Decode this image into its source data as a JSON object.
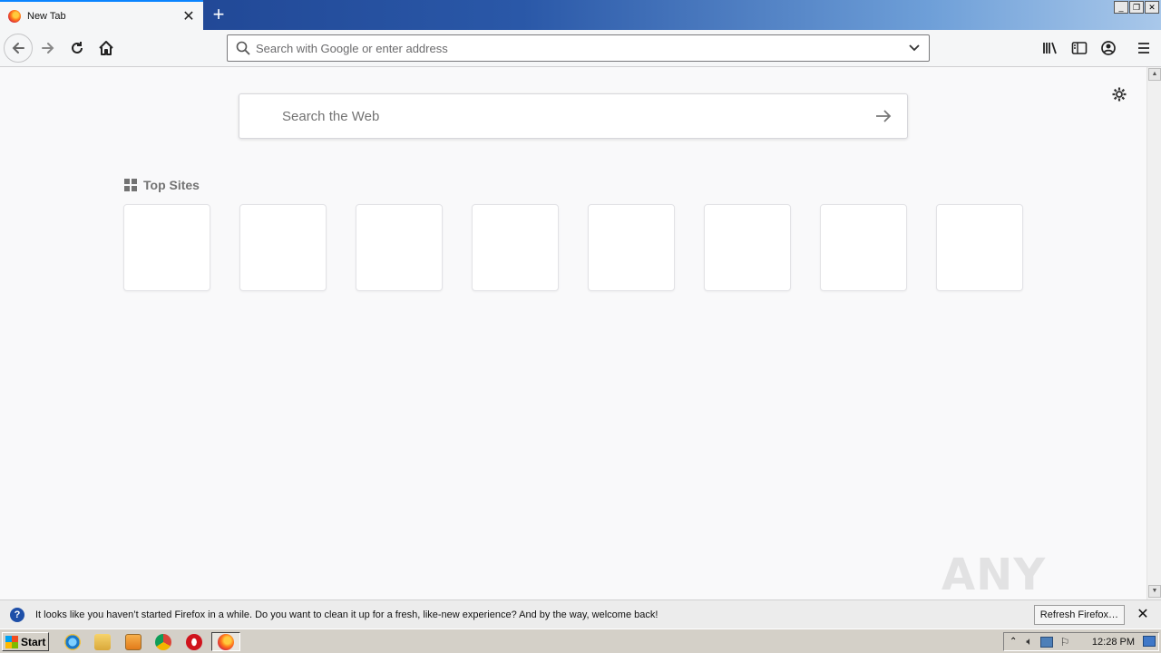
{
  "browser": {
    "tab": {
      "title": "New Tab",
      "close_glyph": "✕"
    },
    "new_tab_glyph": "+",
    "window_controls": {
      "minimize": "_",
      "restore": "❐",
      "close": "✕"
    },
    "nav": {
      "back_icon": "back-arrow-icon",
      "forward_icon": "forward-arrow-icon",
      "reload_icon": "reload-icon",
      "home_icon": "home-icon"
    },
    "urlbar": {
      "placeholder": "Search with Google or enter address",
      "value": ""
    },
    "toolbar_icons": [
      "library-icon",
      "sidebar-icon",
      "account-icon",
      "menu-icon"
    ]
  },
  "newtab": {
    "search_placeholder": "Search the Web",
    "topsites_label": "Top Sites",
    "tiles": [
      "",
      "",
      "",
      "",
      "",
      "",
      "",
      ""
    ]
  },
  "notification": {
    "message": "It looks like you haven’t started Firefox in a while. Do you want to clean it up for a fresh, like-new experience? And by the way, welcome back!",
    "button": "Refresh Firefox…",
    "close_glyph": "✕"
  },
  "taskbar": {
    "start_label": "Start",
    "pinned": [
      "internet-explorer-icon",
      "file-explorer-icon",
      "media-player-icon",
      "chrome-icon",
      "opera-icon",
      "firefox-icon"
    ],
    "clock": "12:28 PM"
  },
  "watermark": "ANY RUN",
  "colors": {
    "accent": "#0a84ff",
    "titlebar_start": "#1c3f8c",
    "titlebar_end": "#a9c8ea"
  }
}
